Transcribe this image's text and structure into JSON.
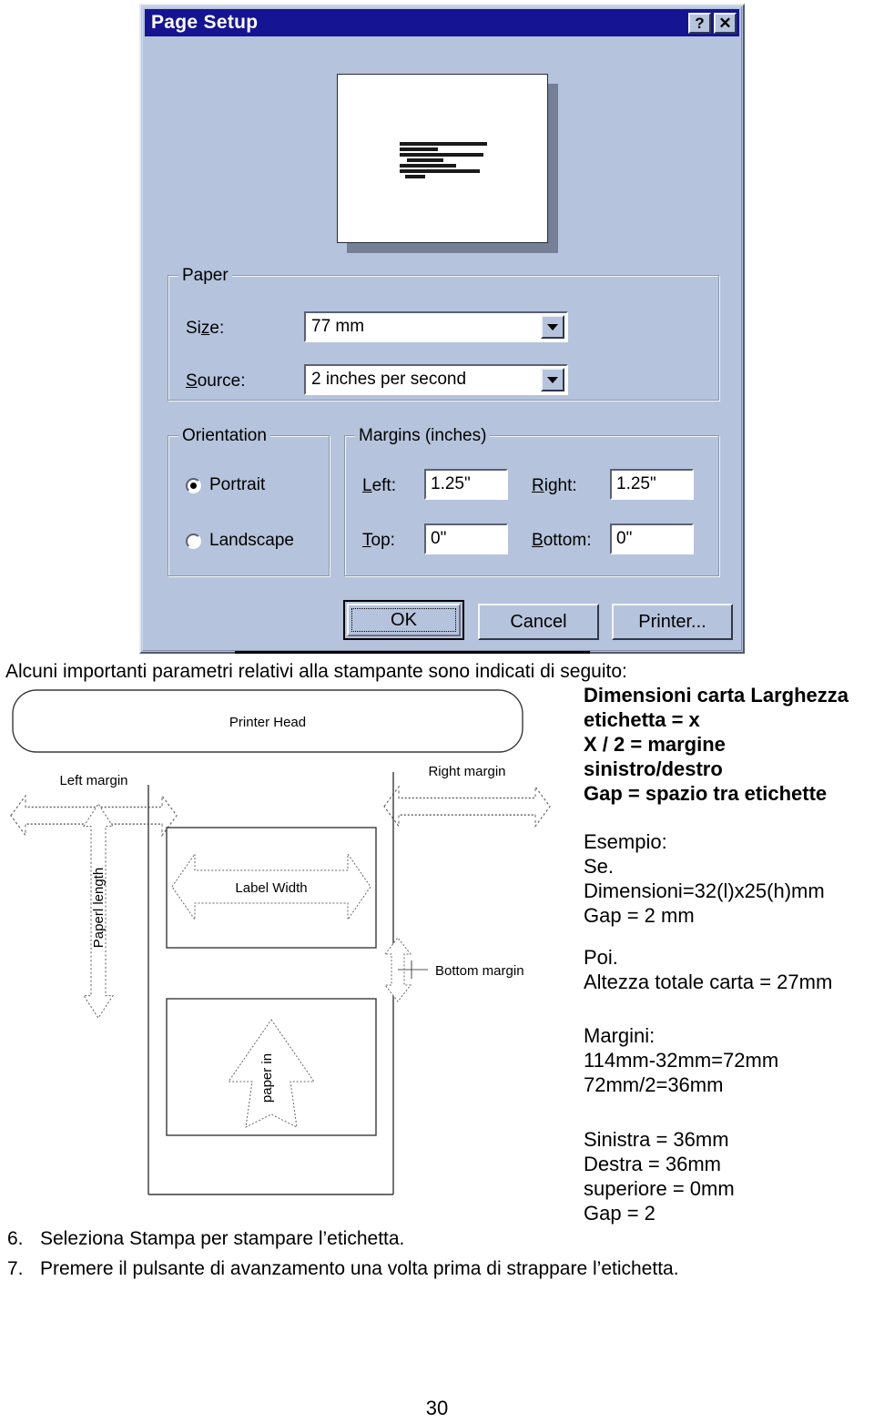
{
  "dialog": {
    "title": "Page Setup",
    "titlebar_buttons": [
      {
        "name": "help",
        "glyph": "?"
      },
      {
        "name": "close",
        "glyph": "✕"
      }
    ],
    "groups": {
      "paper": {
        "title": "Paper",
        "size_label": "Size:",
        "size_value": "77 mm",
        "source_label": "Source:",
        "source_value": "2 inches per second"
      },
      "orientation": {
        "title": "Orientation",
        "options": [
          {
            "label": "Portrait",
            "selected": true
          },
          {
            "label": "Landscape",
            "selected": false
          }
        ]
      },
      "margins": {
        "title": "Margins (inches)",
        "left_label": "Left:",
        "left_value": "1.25\"",
        "right_label": "Right:",
        "right_value": "1.25\"",
        "top_label": "Top:",
        "top_value": "0\"",
        "bottom_label": "Bottom:",
        "bottom_value": "0\""
      }
    },
    "buttons": {
      "ok": "OK",
      "cancel": "Cancel",
      "printer": "Printer..."
    }
  },
  "document": {
    "intro": "Alcuni importanti parametri relativi alla stampante sono indicati di seguito:",
    "diagram_labels": {
      "printer_head": "Printer Head",
      "left_margin": "Left margin",
      "right_margin": "Right margin",
      "paper_length": "Paperl length",
      "label_width": "Label Width",
      "bottom_margin": "Bottom margin",
      "paper_in": "paper in"
    },
    "notes_bold": [
      "Dimensioni carta  Larghezza",
      "etichetta = x",
      "X / 2 = margine",
      "sinistro/destro",
      "Gap = spazio tra etichette"
    ],
    "notes_example": [
      "Esempio:",
      "Se.",
      "Dimensioni=32(l)x25(h)mm",
      "Gap = 2 mm"
    ],
    "notes_result": [
      "Poi.",
      "Altezza totale carta = 27mm"
    ],
    "notes_margins": [
      "Margini:",
      "114mm-32mm=72mm",
      "72mm/2=36mm"
    ],
    "notes_final": [
      "Sinistra = 36mm",
      "Destra = 36mm",
      "superiore = 0mm",
      "Gap = 2"
    ],
    "steps": [
      {
        "num": "6.",
        "text": "Seleziona Stampa per stampare l’etichetta."
      },
      {
        "num": "7.",
        "text": "Premere il pulsante di avanzamento una volta prima di strappare l’etichetta."
      }
    ],
    "page_number": "30"
  },
  "colors": {
    "titlebar": "#151593",
    "dialog_face": "#b6c3dc",
    "field_bg": "#ffffff",
    "text": "#000000"
  }
}
